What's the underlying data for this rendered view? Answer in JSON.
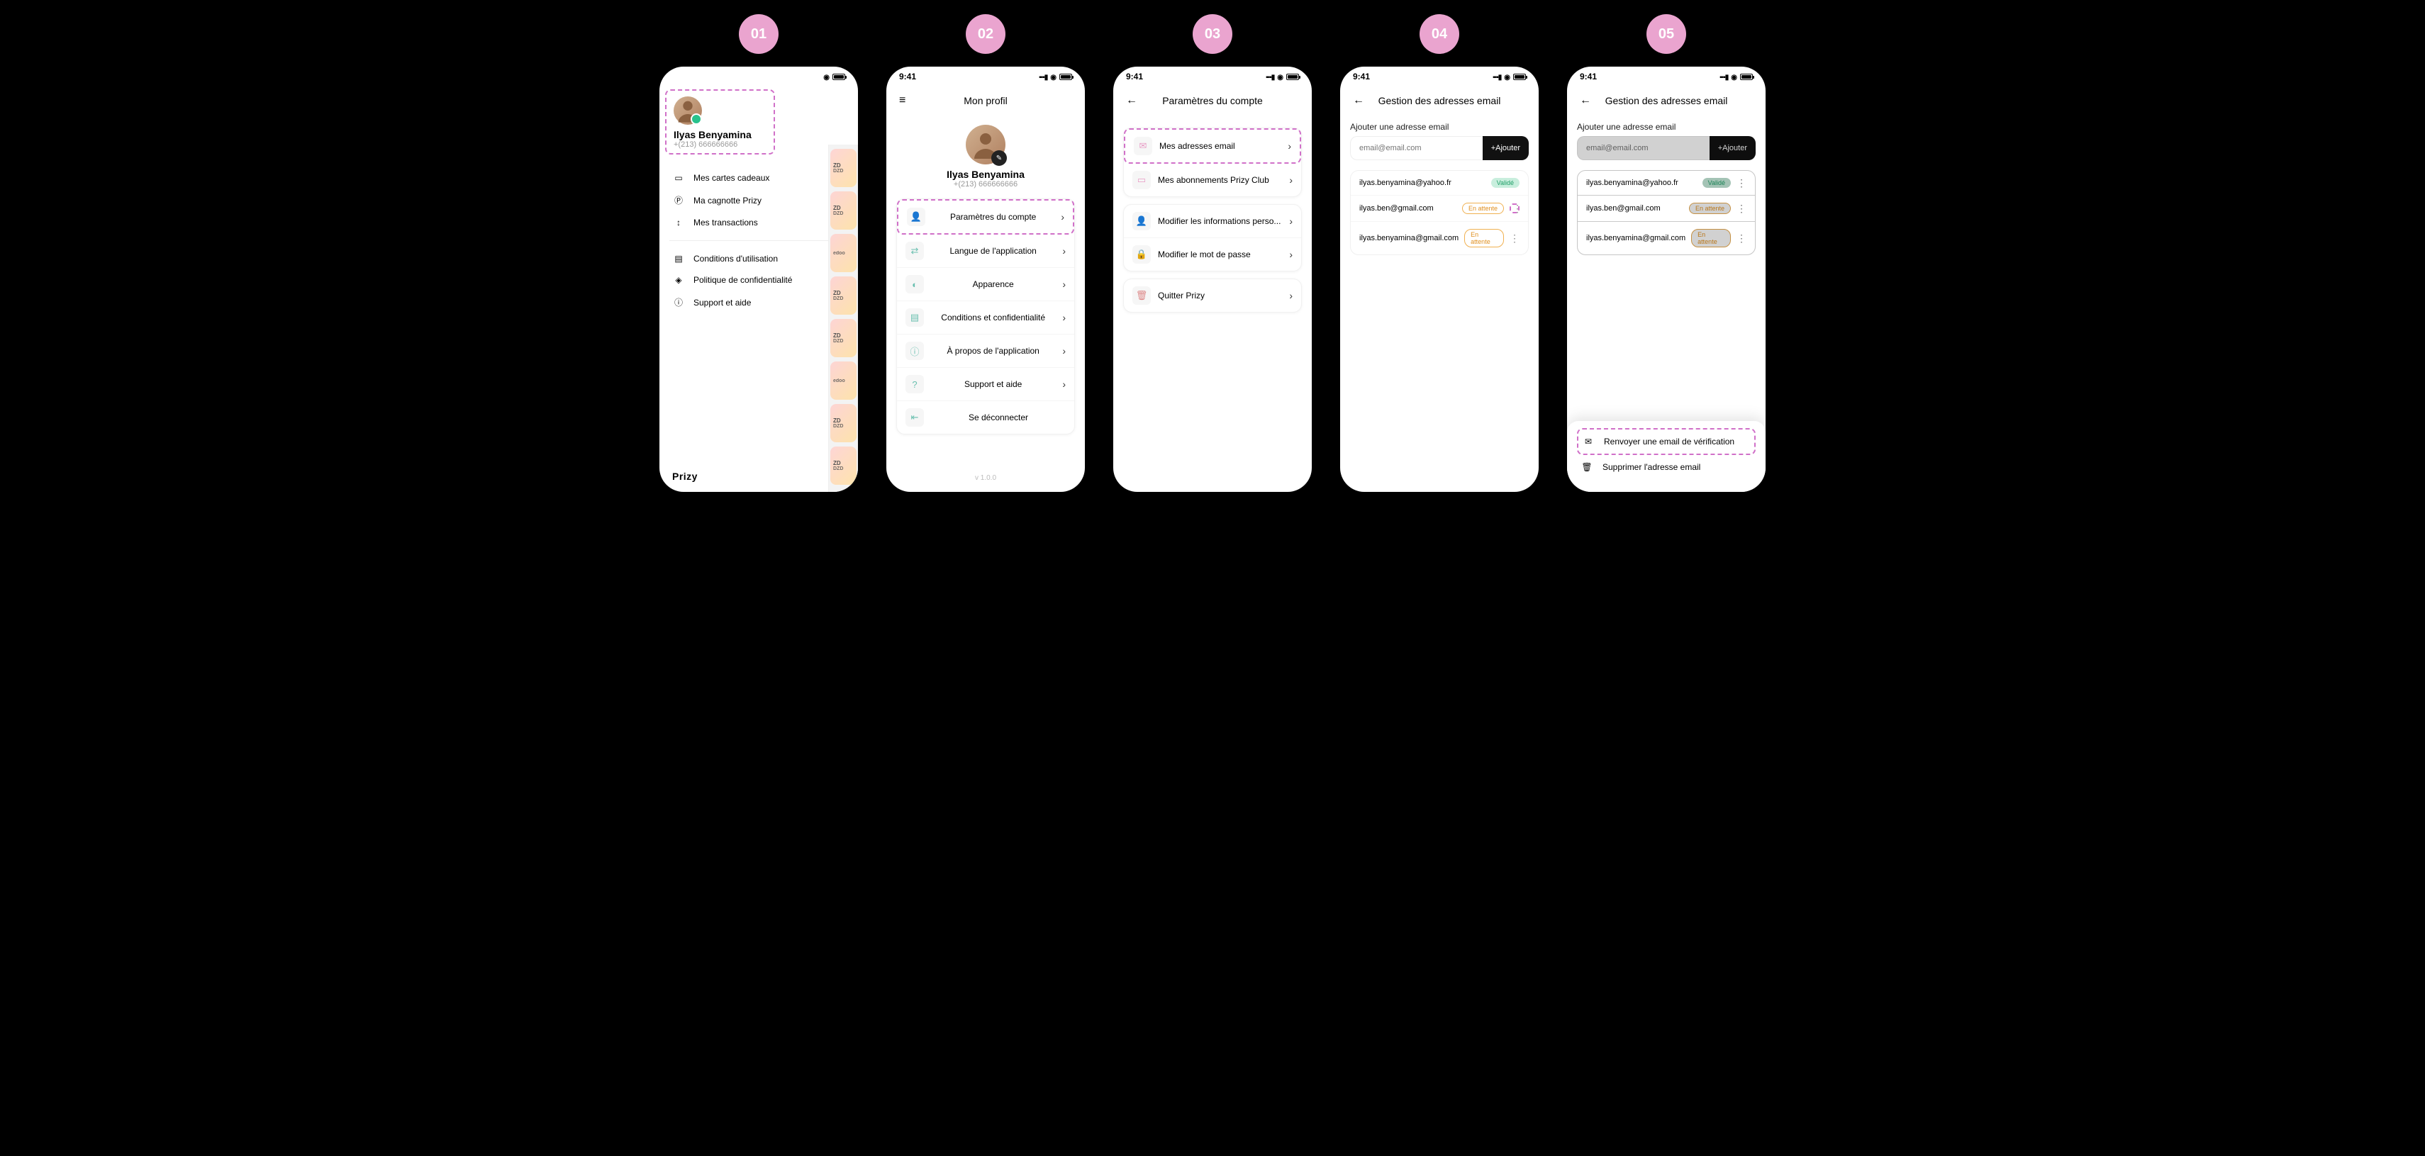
{
  "steps": [
    "01",
    "02",
    "03",
    "04",
    "05"
  ],
  "status_time": "9:41",
  "user": {
    "name": "Ilyas Benyamina",
    "phone": "+(213) 666666666"
  },
  "brand": "Prizy",
  "screen1": {
    "menu": {
      "items": [
        {
          "icon": "card",
          "label": "Mes cartes cadeaux"
        },
        {
          "icon": "coin",
          "label": "Ma cagnotte Prizy"
        },
        {
          "icon": "arrows",
          "label": "Mes transactions"
        }
      ],
      "items2": [
        {
          "icon": "doc",
          "label": "Conditions d'utilisation"
        },
        {
          "icon": "shield",
          "label": "Politique de confidentialité"
        },
        {
          "icon": "info",
          "label": "Support et aide"
        }
      ]
    },
    "bg_cards": [
      {
        "line1": "ZD",
        "line2": "DZD"
      },
      {
        "line1": "ZD",
        "line2": "DZD"
      },
      {
        "line1": "",
        "line2": "edoo"
      },
      {
        "line1": "ZD",
        "line2": "DZD"
      },
      {
        "line1": "ZD",
        "line2": "DZD"
      },
      {
        "line1": "",
        "line2": "edoo"
      },
      {
        "line1": "ZD",
        "line2": "DZD"
      },
      {
        "line1": "ZD",
        "line2": "DZD"
      }
    ]
  },
  "screen2": {
    "title": "Mon profil",
    "version": "v 1.0.0",
    "items": [
      {
        "icon": "user",
        "label": "Paramètres du compte",
        "highlight": true
      },
      {
        "icon": "lang",
        "label": "Langue de l'application"
      },
      {
        "icon": "appear",
        "label": "Apparence"
      },
      {
        "icon": "doc",
        "label": "Conditions et confidentialité"
      },
      {
        "icon": "info",
        "label": "À propos de l'application"
      },
      {
        "icon": "help",
        "label": "Support et aide"
      },
      {
        "icon": "logout",
        "label": "Se déconnecter",
        "nochev": true
      }
    ]
  },
  "screen3": {
    "title": "Paramètres du compte",
    "group1": [
      {
        "icon": "mail",
        "label": "Mes adresses email",
        "highlight": true
      },
      {
        "icon": "club",
        "label": "Mes abonnements Prizy Club"
      }
    ],
    "group2": [
      {
        "icon": "user",
        "label": "Modifier les informations perso..."
      },
      {
        "icon": "lock",
        "label": "Modifier le mot de passe"
      }
    ],
    "group3": [
      {
        "icon": "trash",
        "label": "Quitter Prizy"
      }
    ]
  },
  "screen4": {
    "title": "Gestion des adresses email",
    "add_label": "Ajouter une adresse email",
    "placeholder": "email@email.com",
    "add_btn": "+Ajouter",
    "emails": [
      {
        "addr": "ilyas.benyamina@yahoo.fr",
        "status": "Validé",
        "valid": true,
        "dots": false
      },
      {
        "addr": "ilyas.ben@gmail.com",
        "status": "En attente",
        "valid": false,
        "dots": true,
        "highlight": true
      },
      {
        "addr": "ilyas.benyamina@gmail.com",
        "status": "En attente",
        "valid": false,
        "dots": true
      }
    ]
  },
  "screen5": {
    "title": "Gestion des adresses email",
    "add_label": "Ajouter une adresse email",
    "placeholder": "email@email.com",
    "add_btn": "+Ajouter",
    "emails": [
      {
        "addr": "ilyas.benyamina@yahoo.fr",
        "status": "Validé",
        "valid": true
      },
      {
        "addr": "ilyas.ben@gmail.com",
        "status": "En attente",
        "valid": false
      },
      {
        "addr": "ilyas.benyamina@gmail.com",
        "status": "En attente",
        "valid": false
      }
    ],
    "sheet": [
      {
        "icon": "mail",
        "label": "Renvoyer une email de vérification",
        "highlight": true
      },
      {
        "icon": "trash",
        "label": "Supprimer l'adresse email"
      }
    ]
  }
}
